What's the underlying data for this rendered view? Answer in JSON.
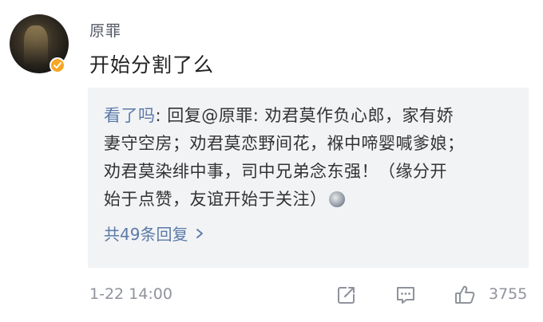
{
  "post": {
    "username": "原罪",
    "text": "开始分割了么"
  },
  "reply": {
    "user": "看了吗",
    "body_lines": [
      ": 回复@原罪: 劝君莫作负心郎，家有娇",
      "妻守空房；劝君莫恋野间花，褓中啼婴喊爹娘；",
      "劝君莫染绯中事，司中兄弟念东强！（缘分开",
      "始于点赞，友谊开始于关注）"
    ],
    "more_label": "共49条回复"
  },
  "footer": {
    "time": "1-22 14:00",
    "like_count": "3755"
  },
  "icons": {
    "badge": "verified-badge-icon",
    "share": "share-icon",
    "comment": "comment-icon",
    "like": "thumbs-up-icon",
    "more_arrow": "chevron-right-icon"
  },
  "colors": {
    "link": "#5b7aa8",
    "badge": "#f5a623",
    "reply_bg": "#f2f3f5"
  }
}
